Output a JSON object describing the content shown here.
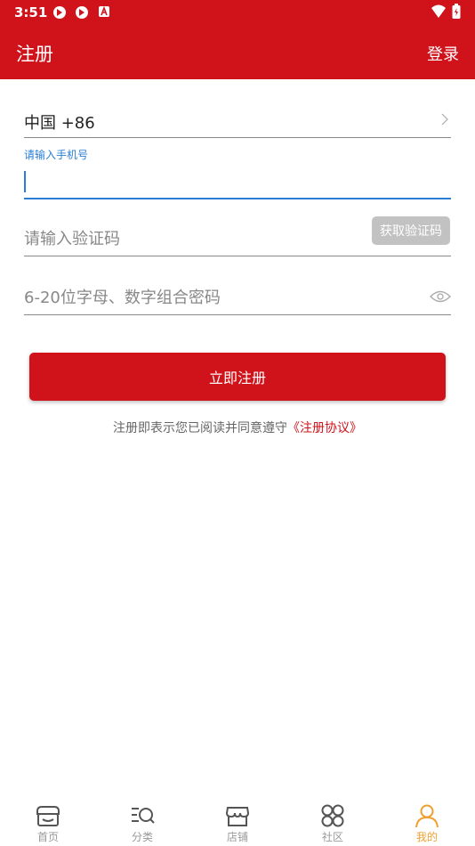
{
  "status_bar": {
    "time": "3:51"
  },
  "app_bar": {
    "title": "注册",
    "login_label": "登录"
  },
  "form": {
    "country_code": "中国 +86",
    "phone_label": "请输入手机号",
    "phone_value": "",
    "code_placeholder": "请输入验证码",
    "get_code_label": "获取验证码",
    "password_placeholder": "6-20位字母、数字组合密码"
  },
  "register_button_label": "立即注册",
  "agreement": {
    "prefix": "注册即表示您已阅读并同意遵守",
    "link": "《注册协议》"
  },
  "tabs": [
    {
      "label": "首页",
      "icon": "home-store-icon"
    },
    {
      "label": "分类",
      "icon": "category-search-icon"
    },
    {
      "label": "店铺",
      "icon": "shop-icon"
    },
    {
      "label": "社区",
      "icon": "community-grid-icon"
    },
    {
      "label": "我的",
      "icon": "profile-icon",
      "active": true
    }
  ],
  "colors": {
    "brand_red": "#d0121b",
    "focus_blue": "#2a7fd4",
    "active_tab": "#f0a030",
    "inactive_tab": "#999999"
  }
}
